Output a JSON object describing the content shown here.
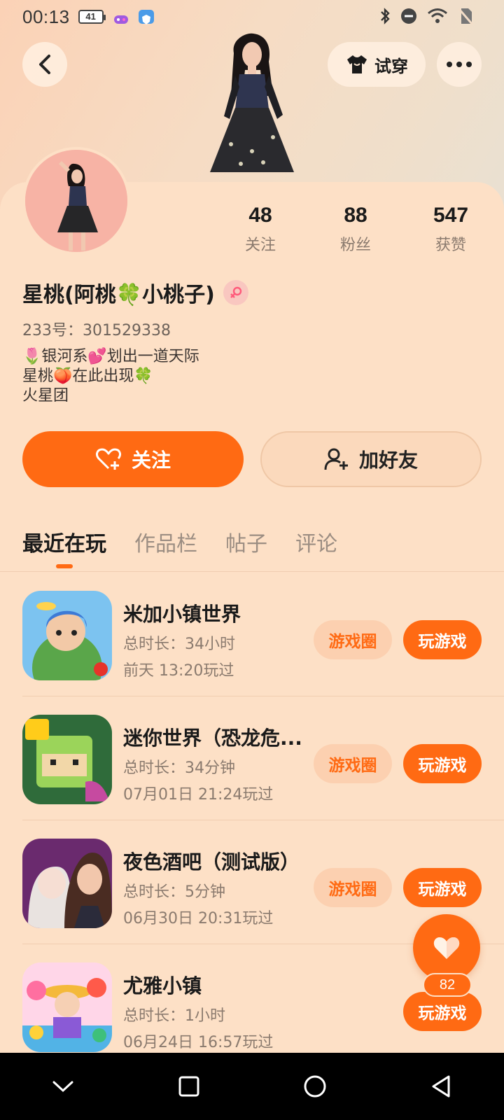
{
  "status_bar": {
    "time": "00:13",
    "battery": "41"
  },
  "header": {
    "tryon_label": "试穿"
  },
  "profile": {
    "nickname": "星桃(阿桃🍀小桃子)",
    "uid": "233号：301529338",
    "bio": [
      "🌷银河系💕划出一道天际",
      "星桃🍑在此出现🍀",
      "火星团"
    ],
    "stats": [
      {
        "value": "48",
        "label": "关注"
      },
      {
        "value": "88",
        "label": "粉丝"
      },
      {
        "value": "547",
        "label": "获赞"
      }
    ],
    "follow_label": "关注",
    "add_friend_label": "加好友"
  },
  "tabs": [
    {
      "label": "最近在玩",
      "active": true
    },
    {
      "label": "作品栏",
      "active": false
    },
    {
      "label": "帖子",
      "active": false
    },
    {
      "label": "评论",
      "active": false
    }
  ],
  "games": [
    {
      "title": "米加小镇世界",
      "duration": "总时长：34小时",
      "last_played": "前天 13:20玩过",
      "circle_label": "游戏圈",
      "play_label": "玩游戏",
      "has_circle": true
    },
    {
      "title": "迷你世界（恐龙危...",
      "duration": "总时长：34分钟",
      "last_played": "07月01日 21:24玩过",
      "circle_label": "游戏圈",
      "play_label": "玩游戏",
      "has_circle": true
    },
    {
      "title": "夜色酒吧（测试版）",
      "duration": "总时长：5分钟",
      "last_played": "06月30日 20:31玩过",
      "circle_label": "游戏圈",
      "play_label": "玩游戏",
      "has_circle": true
    },
    {
      "title": "尤雅小镇",
      "duration": "总时长：1小时",
      "last_played": "06月24日 16:57玩过",
      "circle_label": "",
      "play_label": "玩游戏",
      "has_circle": false
    }
  ],
  "like_fab": {
    "count": "82"
  },
  "colors": {
    "accent": "#ff6a13",
    "background": "#fde0c6",
    "secondary_button": "#fcd0b0"
  },
  "icons": [
    "back-arrow-icon",
    "tshirt-icon",
    "more-dots-icon",
    "heart-plus-icon",
    "add-user-icon",
    "heart-icon",
    "nav-back-icon",
    "nav-home-icon",
    "nav-recent-icon",
    "nav-down-icon"
  ]
}
